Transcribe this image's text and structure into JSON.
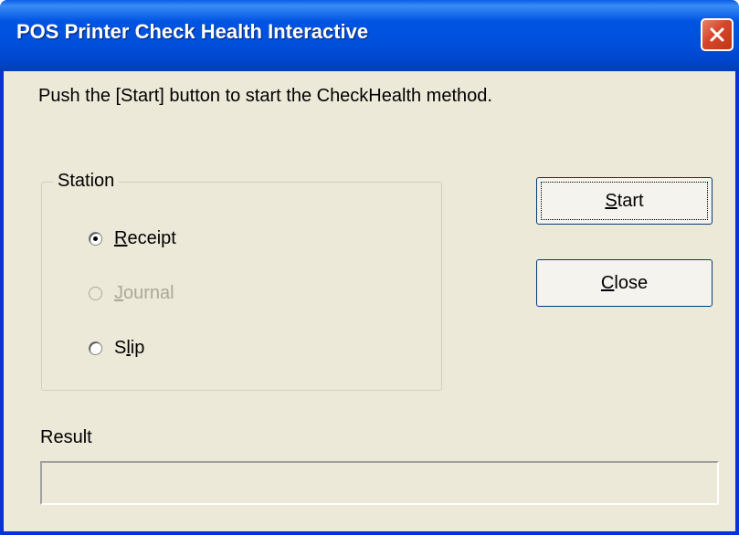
{
  "window": {
    "title": "POS Printer Check Health Interactive",
    "close_icon": "close-icon"
  },
  "message": "Push the [Start] button to start the CheckHealth method.",
  "station": {
    "label": "Station",
    "options": [
      {
        "mnemonic": "R",
        "rest": "eceipt",
        "selected": true,
        "enabled": true
      },
      {
        "mnemonic": "J",
        "rest": "ournal",
        "selected": false,
        "enabled": false
      },
      {
        "prefix": "S",
        "mnemonic": "l",
        "rest": "ip",
        "selected": false,
        "enabled": true
      }
    ]
  },
  "buttons": {
    "start": {
      "mnemonic": "S",
      "rest": "tart"
    },
    "close": {
      "mnemonic": "C",
      "rest": "lose"
    }
  },
  "result": {
    "label": "Result",
    "value": ""
  },
  "colors": {
    "titlebar": "#0054E3",
    "dialog_bg": "#ECE9D8",
    "close_button": "#D6452B",
    "disabled_text": "#ACA899"
  }
}
